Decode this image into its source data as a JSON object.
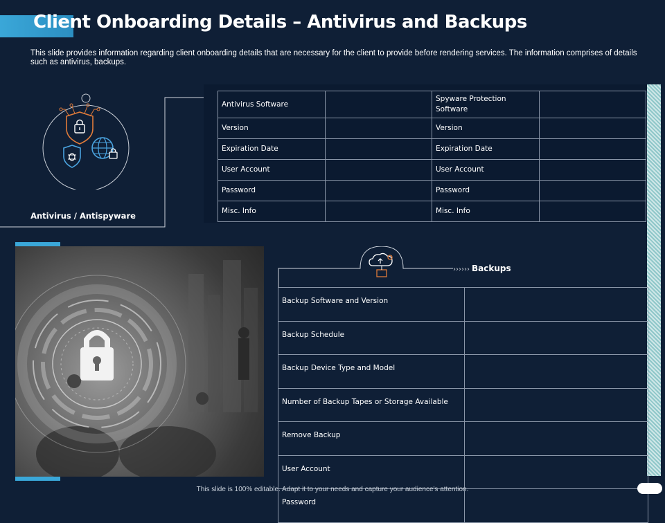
{
  "header": {
    "title": "Client Onboarding Details – Antivirus and Backups",
    "description": "This slide provides information regarding client onboarding details that are necessary for the client to provide before rendering services. The information comprises of details such as antivirus, backups."
  },
  "antivirus": {
    "label": "Antivirus / Antispyware",
    "icon": "shield-lock-globe-icon",
    "rows": [
      {
        "label1": "Antivirus Software",
        "value1": "",
        "label2": "Spyware Protection Software",
        "value2": ""
      },
      {
        "label1": "Version",
        "value1": "",
        "label2": "Version",
        "value2": ""
      },
      {
        "label1": "Expiration Date",
        "value1": "",
        "label2": "Expiration Date",
        "value2": ""
      },
      {
        "label1": "User Account",
        "value1": "",
        "label2": "User Account",
        "value2": ""
      },
      {
        "label1": "Password",
        "value1": "",
        "label2": "Password",
        "value2": ""
      },
      {
        "label1": "Misc. Info",
        "value1": "",
        "label2": "Misc. Info",
        "value2": ""
      }
    ]
  },
  "backups": {
    "title": "Backups",
    "icon": "cloud-backup-icon",
    "rows": [
      {
        "label": "Backup Software and Version",
        "value": ""
      },
      {
        "label": "Backup Schedule",
        "value": ""
      },
      {
        "label": "Backup Device Type and Model",
        "value": ""
      },
      {
        "label": "Number of Backup Tapes or Storage Available",
        "value": ""
      },
      {
        "label": "Remove Backup",
        "value": ""
      },
      {
        "label": "User Account",
        "value": ""
      },
      {
        "label": "Password",
        "value": ""
      }
    ]
  },
  "footer": {
    "note": "This slide is 100% editable.  Adapt it to your needs and capture your audience's attention."
  },
  "colors": {
    "background": "#0f1f36",
    "accent": "#3aa7d8",
    "icon_orange": "#e07b3a",
    "icon_blue": "#4aa3df"
  }
}
